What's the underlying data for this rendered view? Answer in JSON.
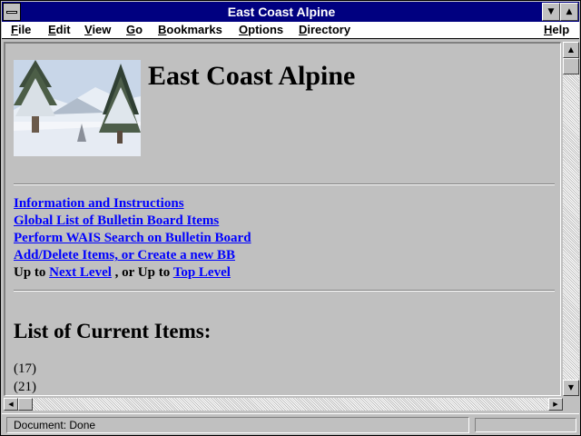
{
  "window": {
    "title": "East Coast Alpine"
  },
  "menu": {
    "items": [
      "File",
      "Edit",
      "View",
      "Go",
      "Bookmarks",
      "Options",
      "Directory"
    ],
    "help": "Help"
  },
  "page": {
    "heading": "East Coast Alpine",
    "links": [
      "Information and Instructions",
      "Global List of Bulletin Board Items",
      "Perform WAIS Search on Bulletin Board",
      "Add/Delete Items, or Create a new BB"
    ],
    "nav": {
      "up_to": "Up to",
      "next_level": "Next Level",
      "or_up_to": ", or Up to",
      "top_level": "Top Level"
    },
    "list_heading": "List of Current Items:",
    "items": [
      "(17)",
      "(21)"
    ]
  },
  "status": {
    "text": "Document: Done"
  },
  "colors": {
    "title_bar": "#000080",
    "link": "#0000ff",
    "chrome": "#c0c0c0"
  }
}
